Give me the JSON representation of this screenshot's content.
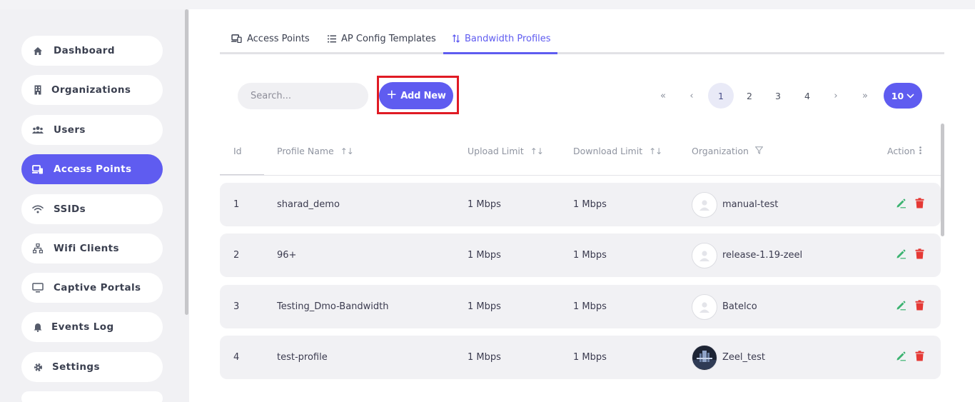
{
  "sidebar": {
    "items": [
      {
        "label": "Dashboard",
        "icon": "home-icon"
      },
      {
        "label": "Organizations",
        "icon": "building-icon"
      },
      {
        "label": "Users",
        "icon": "users-icon"
      },
      {
        "label": "Access Points",
        "icon": "devices-icon",
        "active": true
      },
      {
        "label": "SSIDs",
        "icon": "wifi-icon"
      },
      {
        "label": "Wifi Clients",
        "icon": "network-icon"
      },
      {
        "label": "Captive Portals",
        "icon": "monitor-icon"
      },
      {
        "label": "Events Log",
        "icon": "bell-icon"
      },
      {
        "label": "Settings",
        "icon": "gear-icon"
      }
    ]
  },
  "tabs": [
    {
      "label": "Access Points",
      "icon": "devices-icon"
    },
    {
      "label": "AP Config Templates",
      "icon": "list-icon"
    },
    {
      "label": "Bandwidth Profiles",
      "icon": "sort-icon",
      "active": true
    }
  ],
  "toolbar": {
    "search_placeholder": "Search...",
    "add_label": "Add New"
  },
  "pagination": {
    "first": "«",
    "prev": "‹",
    "pages": [
      "1",
      "2",
      "3",
      "4"
    ],
    "current": "1",
    "next": "›",
    "last": "»",
    "per_page": "10"
  },
  "table": {
    "columns": [
      "Id",
      "Profile Name",
      "Upload Limit",
      "Download Limit",
      "Organization",
      "Action"
    ],
    "rows": [
      {
        "id": "1",
        "name": "sharad_demo",
        "upload": "1 Mbps",
        "download": "1 Mbps",
        "org": "manual-test"
      },
      {
        "id": "2",
        "name": "96+",
        "upload": "1 Mbps",
        "download": "1 Mbps",
        "org": "release-1.19-zeel"
      },
      {
        "id": "3",
        "name": "Testing_Dmo-Bandwidth",
        "upload": "1 Mbps",
        "download": "1 Mbps",
        "org": "Batelco"
      },
      {
        "id": "4",
        "name": "test-profile",
        "upload": "1 Mbps",
        "download": "1 Mbps",
        "org": "Zeel_test"
      }
    ]
  },
  "colors": {
    "accent": "#5f5cf0",
    "edit": "#3cb371",
    "delete": "#e53935",
    "highlight": "#e01b24"
  }
}
